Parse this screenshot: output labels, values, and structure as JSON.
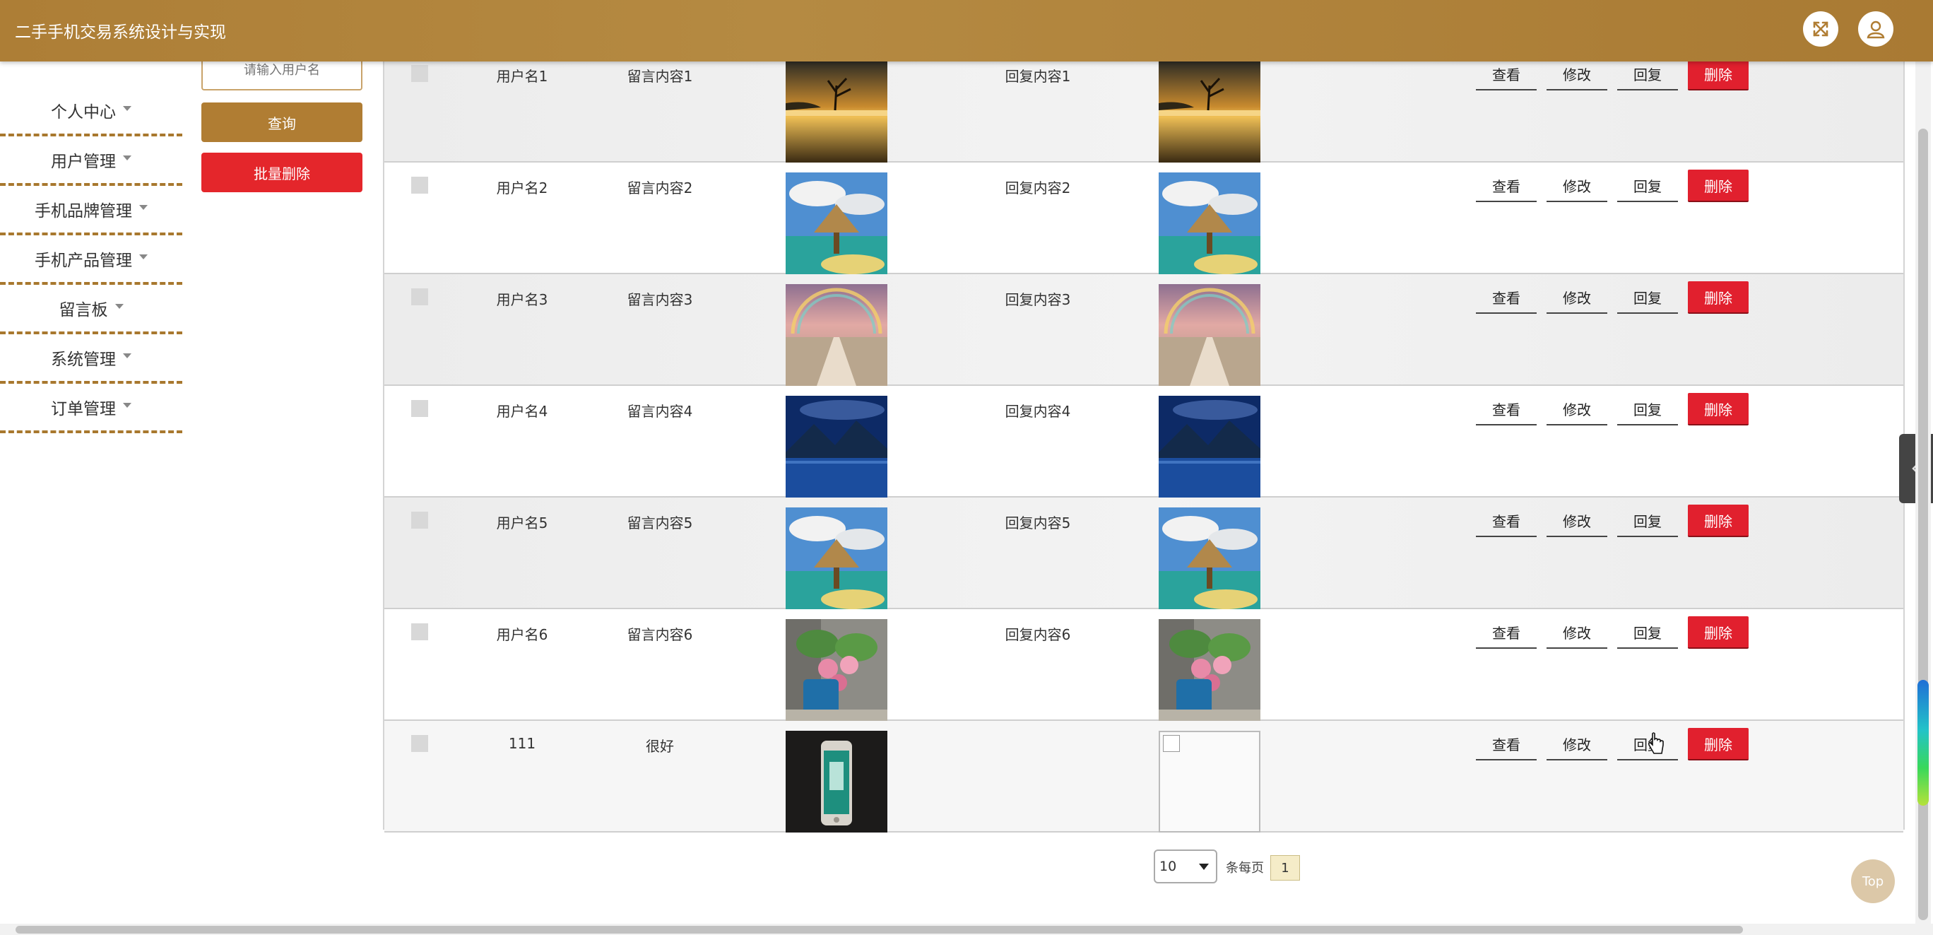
{
  "header": {
    "title": "二手手机交易系统设计与实现"
  },
  "sidebar": {
    "items": [
      {
        "label": "个人中心"
      },
      {
        "label": "用户管理"
      },
      {
        "label": "手机品牌管理"
      },
      {
        "label": "手机产品管理"
      },
      {
        "label": "留言板"
      },
      {
        "label": "系统管理"
      },
      {
        "label": "订单管理"
      }
    ]
  },
  "filter": {
    "placeholder": "请输入用户名",
    "query_label": "查询",
    "batch_delete_label": "批量删除"
  },
  "actions": {
    "view": "查看",
    "edit": "修改",
    "reply": "回复",
    "delete": "删除"
  },
  "rows": [
    {
      "username": "用户名1",
      "message": "留言内容1",
      "reply": "回复内容1",
      "image": "lake-tree-sunset"
    },
    {
      "username": "用户名2",
      "message": "留言内容2",
      "reply": "回复内容2",
      "image": "tropical-hut-lake"
    },
    {
      "username": "用户名3",
      "message": "留言内容3",
      "reply": "回复内容3",
      "image": "rainbow-flower-path"
    },
    {
      "username": "用户名4",
      "message": "留言内容4",
      "reply": "回复内容4",
      "image": "mountain-lake-night"
    },
    {
      "username": "用户名5",
      "message": "留言内容5",
      "reply": "回复内容5",
      "image": "tropical-hut-lake"
    },
    {
      "username": "用户名6",
      "message": "留言内容6",
      "reply": "回复内容6",
      "image": "pink-roses-watering-can"
    },
    {
      "username": "111",
      "message": "很好",
      "reply": "",
      "image": "smartphone",
      "reply_image": "broken-image"
    }
  ],
  "pagination": {
    "page_size": "10",
    "per_page_label": "条每页",
    "current_page": "1"
  },
  "top_button": "Top",
  "colors": {
    "header": "#b07d33",
    "danger": "#e1202e",
    "accent": "#a8782e"
  }
}
